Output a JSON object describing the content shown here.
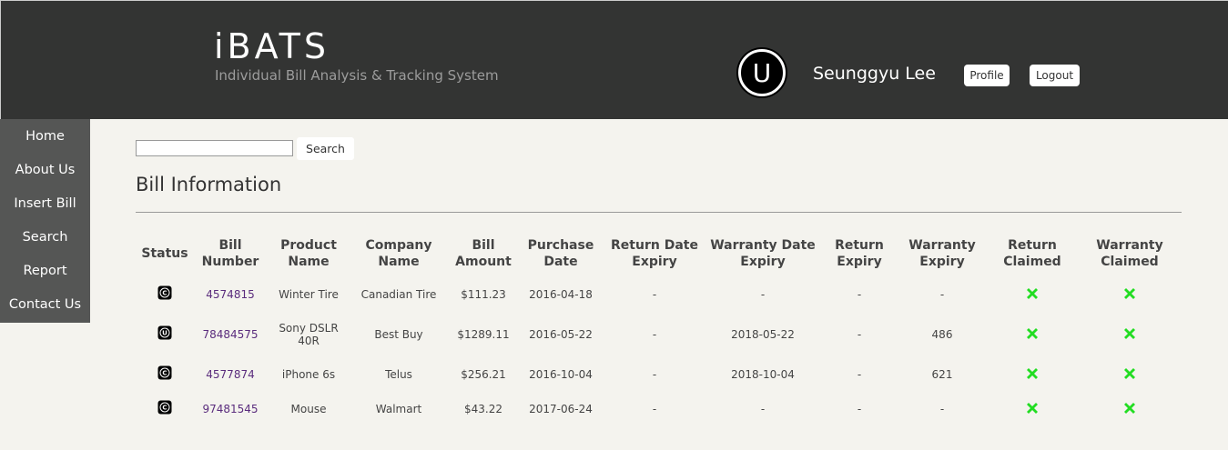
{
  "header": {
    "title": "iBATS",
    "subtitle": "Individual Bill Analysis & Tracking System",
    "avatar_letter": "U",
    "user_name": "Seunggyu Lee",
    "profile_label": "Profile",
    "logout_label": "Logout"
  },
  "sidebar": {
    "items": [
      {
        "label": "Home"
      },
      {
        "label": "About Us"
      },
      {
        "label": "Insert Bill"
      },
      {
        "label": "Search"
      },
      {
        "label": "Report"
      },
      {
        "label": "Contact Us"
      }
    ]
  },
  "search": {
    "value": "",
    "button_label": "Search"
  },
  "section_title": "Bill Information",
  "table": {
    "headers": [
      [
        "Status"
      ],
      [
        "Bill",
        "Number"
      ],
      [
        "Product",
        "Name"
      ],
      [
        "Company",
        "Name"
      ],
      [
        "Bill",
        "Amount"
      ],
      [
        "Purchase",
        "Date"
      ],
      [
        "Return Date",
        "Expiry"
      ],
      [
        "Warranty Date",
        "Expiry"
      ],
      [
        "Return",
        "Expiry"
      ],
      [
        "Warranty",
        "Expiry"
      ],
      [
        "Return",
        "Claimed"
      ],
      [
        "Warranty",
        "Claimed"
      ]
    ],
    "rows": [
      {
        "status": "C",
        "bill_number": "4574815",
        "product": "Winter Tire",
        "company": "Canadian Tire",
        "amount": "$111.23",
        "purchase_date": "2016-04-18",
        "return_date_expiry": "-",
        "warranty_date_expiry": "-",
        "return_expiry": "-",
        "warranty_expiry": "-",
        "return_claimed": false,
        "warranty_claimed": false
      },
      {
        "status": "U",
        "bill_number": "78484575",
        "product": "Sony DSLR 40R",
        "company": "Best Buy",
        "amount": "$1289.11",
        "purchase_date": "2016-05-22",
        "return_date_expiry": "-",
        "warranty_date_expiry": "2018-05-22",
        "return_expiry": "-",
        "warranty_expiry": "486",
        "return_claimed": false,
        "warranty_claimed": false
      },
      {
        "status": "C",
        "bill_number": "4577874",
        "product": "iPhone 6s",
        "company": "Telus",
        "amount": "$256.21",
        "purchase_date": "2016-10-04",
        "return_date_expiry": "-",
        "warranty_date_expiry": "2018-10-04",
        "return_expiry": "-",
        "warranty_expiry": "621",
        "return_claimed": false,
        "warranty_claimed": false
      },
      {
        "status": "C",
        "bill_number": "97481545",
        "product": "Mouse",
        "company": "Walmart",
        "amount": "$43.22",
        "purchase_date": "2017-06-24",
        "return_date_expiry": "-",
        "warranty_date_expiry": "-",
        "return_expiry": "-",
        "warranty_expiry": "-",
        "return_claimed": false,
        "warranty_claimed": false
      }
    ]
  },
  "colors": {
    "header_bg": "#333433",
    "sidebar_bg": "#555655",
    "page_bg": "#f4f3ee",
    "link": "#5a2c7d",
    "claimed_no": "#22dd22"
  },
  "icons": {
    "status": "status-circle-icon",
    "not_claimed": "green-x-icon"
  }
}
